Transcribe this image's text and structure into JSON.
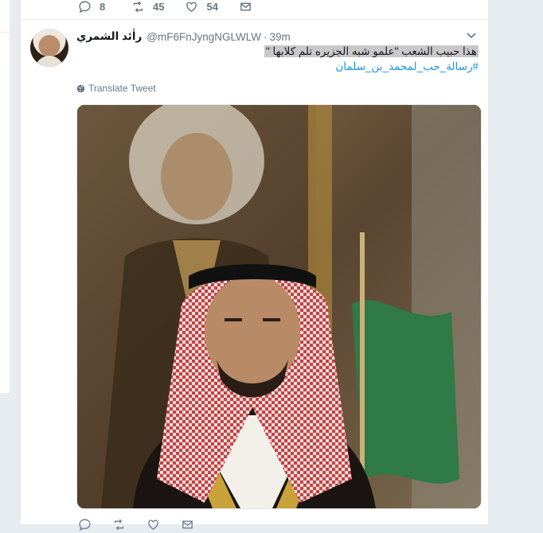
{
  "previous_tweet": {
    "replies": "8",
    "retweets": "45",
    "likes": "54"
  },
  "tweet": {
    "display_name": "راٰئد الشمري",
    "handle": "@mF6FnJyngNGLWLW",
    "separator": "·",
    "time": "39m",
    "text_selected": "هذا حبيب الشعب \"علمو شبه الجزيره تلم كلابها \"",
    "hashtag": "#رسالة_حب_لمحمد_بن_سلمان",
    "translate_label": "Translate Tweet"
  },
  "colors": {
    "link": "#1b95e0",
    "muted": "#657786",
    "background": "#e6ecf0",
    "selection": "#c8c8c8"
  },
  "icons": [
    "reply-icon",
    "retweet-icon",
    "like-icon",
    "message-icon",
    "globe-icon",
    "caret-down-icon"
  ]
}
